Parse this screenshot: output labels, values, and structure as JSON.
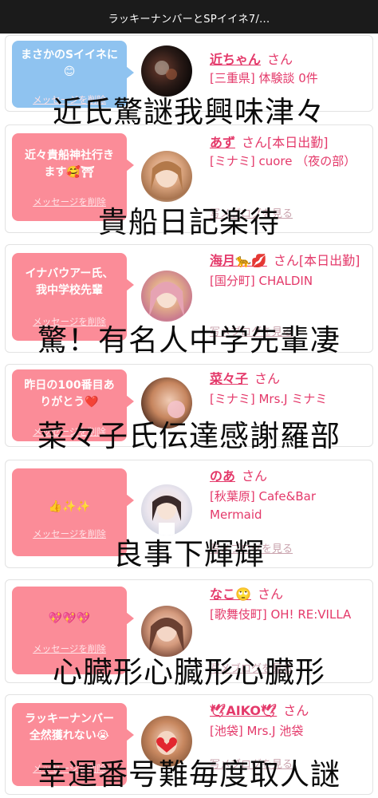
{
  "header": {
    "title": "ラッキーナンバーとSPイイネ7/..."
  },
  "cards": [
    {
      "message": "まさかのSイイネに😊",
      "delete_label": "メッセージを削除",
      "name": "近ちゃん",
      "san": "さん",
      "shop_line": "[三重県] 体験談 0件",
      "blog_label": "",
      "caption": "近氏驚謎我興味津々",
      "bubble_color": "#8fc3f0"
    },
    {
      "message": "近々貴船神社行きます🥰⛩",
      "delete_label": "メッセージを削除",
      "name": "あず",
      "san": "さん[本日出勤]",
      "shop_line": "[ミナミ] cuore （夜の部）",
      "blog_label": "写メブログを見る",
      "caption": "貴船日記楽待",
      "bubble_color": "#fb8c98"
    },
    {
      "message": "イナバウアー氏、我中学校先輩",
      "delete_label": "メッセージを削除",
      "name": "海月🐆💋",
      "san": "さん[本日出勤]",
      "shop_line": "[国分町] CHALDIN",
      "blog_label": "写メブログを見る",
      "caption": "驚！有名人中学先輩凄",
      "bubble_color": "#fb8c98"
    },
    {
      "message": "昨日の100番目ありがとう❤️",
      "delete_label": "メッセージを削除",
      "name": "菜々子",
      "san": "さん",
      "shop_line": "[ミナミ] Mrs.J ミナミ",
      "blog_label": "",
      "caption": "菜々子氏伝達感謝羅部",
      "bubble_color": "#fb8c98"
    },
    {
      "message": "👍✨✨",
      "delete_label": "メッセージを削除",
      "name": "のあ",
      "san": "さん",
      "shop_line": "[秋葉原] Cafe&Bar Mermaid",
      "blog_label": "写メブログを見る",
      "caption": "良事下輝輝",
      "bubble_color": "#fb8c98"
    },
    {
      "message": "💖💖💖",
      "delete_label": "メッセージを削除",
      "name": "なこ🙄",
      "san": "さん",
      "shop_line": "[歌舞伎町] OH! RE:VILLA",
      "blog_label": "写メブログを見る",
      "caption": "心臓形心臓形心臓形",
      "bubble_color": "#fb8c98"
    },
    {
      "message": "ラッキーナンバー全然獲れない😭",
      "delete_label": "メッセージを削除",
      "name": "🕊AIKO🕊",
      "san": "さん",
      "shop_line": "[池袋] Mrs.J 池袋",
      "blog_label": "写メブログを見る",
      "caption": "幸運番号難毎度取人謎",
      "bubble_color": "#fb8c98"
    }
  ]
}
